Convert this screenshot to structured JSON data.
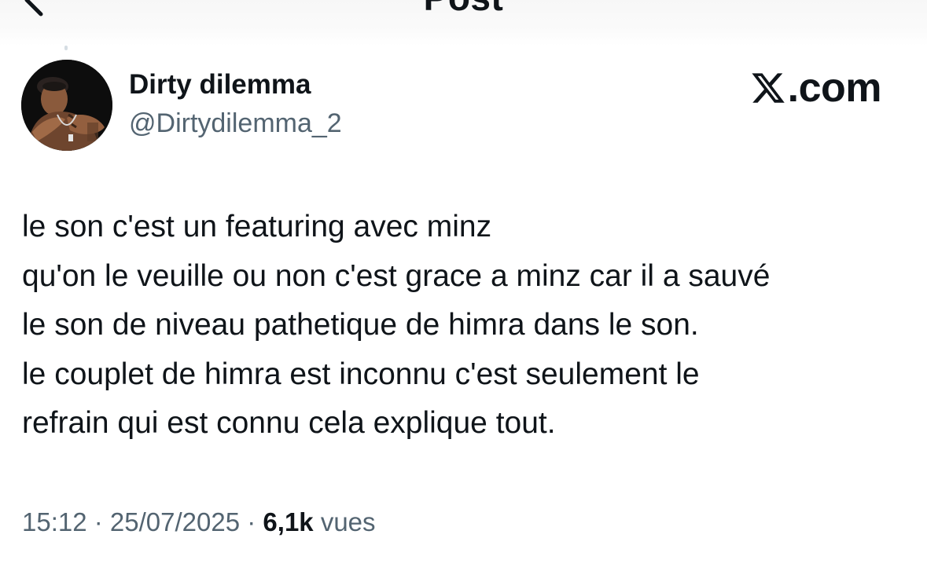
{
  "header": {
    "title": "Post",
    "back_icon": "back-arrow-icon"
  },
  "author": {
    "display_name": "Dirty dilemma",
    "handle": "@Dirtydilemma_2",
    "avatar_icon": "avatar-photo"
  },
  "brand": {
    "logo_icon": "x-logo-icon",
    "domain_suffix": ".com"
  },
  "tweet": {
    "lines": [
      "le son c'est un featuring avec minz",
      "qu'on le veuille ou non c'est grace a minz car il a sauvé",
      "le son de niveau pathetique de himra dans le son.",
      "le couplet de himra est inconnu c'est seulement le",
      "refrain qui est connu cela explique tout."
    ]
  },
  "meta": {
    "time": "15:12",
    "separator": " · ",
    "date": "25/07/2025",
    "views_count": "6,1k",
    "views_label": " vues"
  },
  "colors": {
    "text_primary": "#0f1419",
    "text_secondary": "#536471",
    "background": "#ffffff"
  }
}
